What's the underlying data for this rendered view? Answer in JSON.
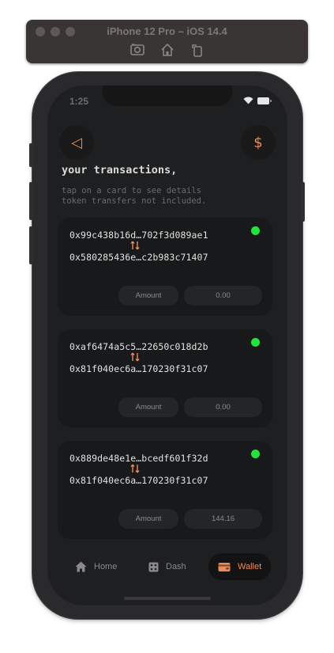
{
  "simulator": {
    "title": "iPhone 12 Pro – iOS 14.4",
    "toolbar_icons": [
      "screenshot-icon",
      "home-icon",
      "rotate-icon"
    ]
  },
  "status_bar": {
    "time": "1:25"
  },
  "header": {
    "back_icon": "◁",
    "currency_icon": "$",
    "title": "your transactions,",
    "subtitle_line1": "tap on a card to see details",
    "subtitle_line2": "token transfers not included."
  },
  "transactions": [
    {
      "from": "0x99c438b16d…702f3d089ae1",
      "to": "0x580285436e…c2b983c71407",
      "amount_label": "Amount",
      "amount": "0.00",
      "status_color": "#22e53c"
    },
    {
      "from": "0xaf6474a5c5…22650c018d2b",
      "to": "0x81f040ec6a…170230f31c07",
      "amount_label": "Amount",
      "amount": "0.00",
      "status_color": "#22e53c"
    },
    {
      "from": "0x889de48e1e…bcedf601f32d",
      "to": "0x81f040ec6a…170230f31c07",
      "amount_label": "Amount",
      "amount": "144.16",
      "status_color": "#22e53c"
    }
  ],
  "nav": {
    "items": [
      {
        "label": "Home",
        "icon": "home-icon",
        "active": false
      },
      {
        "label": "Dash",
        "icon": "dice-icon",
        "active": false
      },
      {
        "label": "Wallet",
        "icon": "wallet-icon",
        "active": true
      }
    ]
  },
  "colors": {
    "accent": "#f08a55",
    "status_ok": "#22e53c",
    "background": "#1e1f20",
    "card": "#18191a"
  }
}
